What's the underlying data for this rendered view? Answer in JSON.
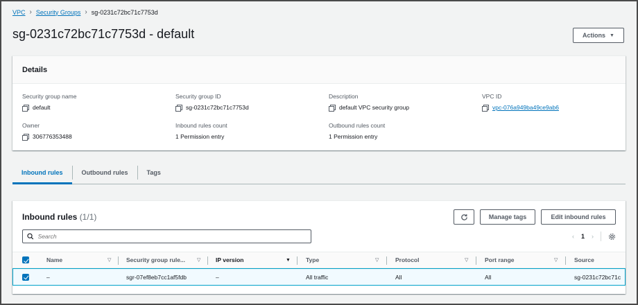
{
  "breadcrumb": {
    "items": [
      "VPC",
      "Security Groups"
    ],
    "current": "sg-0231c72bc71c7753d"
  },
  "page": {
    "title": "sg-0231c72bc71c7753d - default",
    "actions_label": "Actions"
  },
  "details": {
    "heading": "Details",
    "fields": {
      "sg_name": {
        "label": "Security group name",
        "value": "default"
      },
      "sg_id": {
        "label": "Security group ID",
        "value": "sg-0231c72bc71c7753d"
      },
      "description": {
        "label": "Description",
        "value": "default VPC security group"
      },
      "vpc_id": {
        "label": "VPC ID",
        "value": "vpc-076a949ba49ce9ab6"
      },
      "owner": {
        "label": "Owner",
        "value": "306776353488"
      },
      "inbound_count": {
        "label": "Inbound rules count",
        "value": "1 Permission entry"
      },
      "outbound_count": {
        "label": "Outbound rules count",
        "value": "1 Permission entry"
      }
    }
  },
  "tabs": [
    "Inbound rules",
    "Outbound rules",
    "Tags"
  ],
  "inbound": {
    "title": "Inbound rules",
    "count": "(1/1)",
    "manage_tags_label": "Manage tags",
    "edit_label": "Edit inbound rules",
    "search_placeholder": "Search",
    "page_number": "1",
    "columns": [
      "Name",
      "Security group rule...",
      "IP version",
      "Type",
      "Protocol",
      "Port range",
      "Source"
    ],
    "rows": [
      {
        "name": "–",
        "rule_id": "sgr-07ef8eb7cc1af5fdb",
        "ip_version": "–",
        "type": "All traffic",
        "protocol": "All",
        "port_range": "All",
        "source": "sg-0231c72bc71c"
      }
    ]
  },
  "colors": {
    "link": "#0073bb",
    "selected_row_bg": "#f1faff",
    "selected_row_border": "#00a1c9"
  }
}
